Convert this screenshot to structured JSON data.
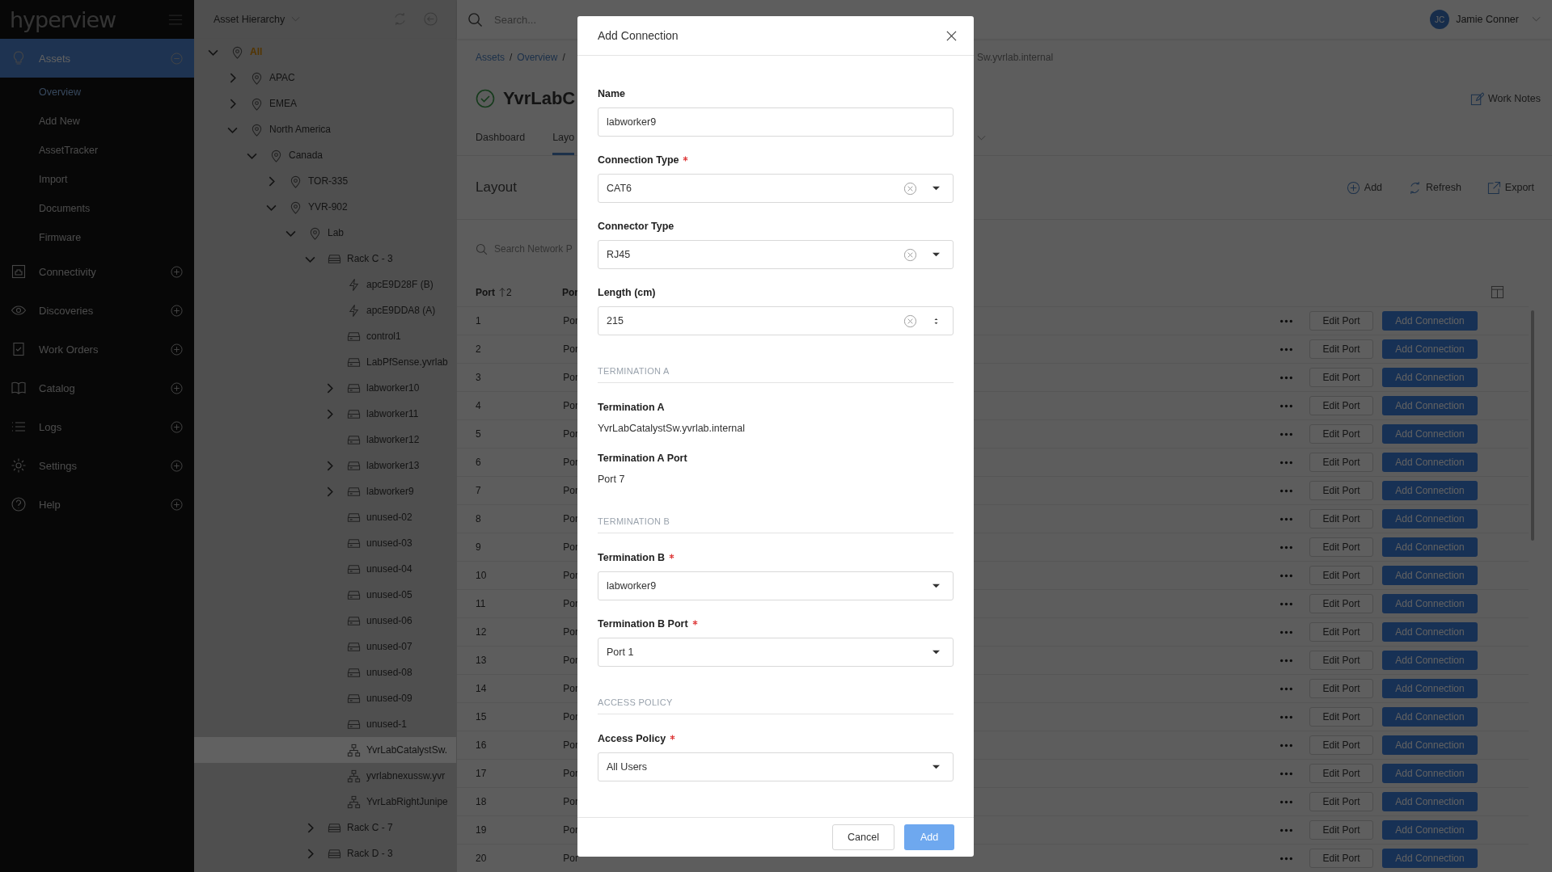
{
  "sidebar": {
    "logo": "hyperview",
    "items": [
      {
        "label": "Assets",
        "selected": true,
        "expanded": true,
        "children": [
          {
            "label": "Overview",
            "selected": true
          },
          {
            "label": "Add New",
            "selected": false
          },
          {
            "label": "AssetTracker",
            "selected": false
          },
          {
            "label": "Import",
            "selected": false
          },
          {
            "label": "Documents",
            "selected": false
          },
          {
            "label": "Firmware",
            "selected": false
          }
        ]
      },
      {
        "label": "Connectivity",
        "selected": false,
        "expanded": false
      },
      {
        "label": "Discoveries",
        "selected": false,
        "expanded": false
      },
      {
        "label": "Work Orders",
        "selected": false,
        "expanded": false
      },
      {
        "label": "Catalog",
        "selected": false,
        "expanded": false
      },
      {
        "label": "Logs",
        "selected": false,
        "expanded": false
      },
      {
        "label": "Settings",
        "selected": false,
        "expanded": false
      },
      {
        "label": "Help",
        "selected": false,
        "expanded": false
      }
    ]
  },
  "tree_panel": {
    "title": "Asset Hierarchy",
    "nodes": [
      {
        "label": "All",
        "kind": "location",
        "selected": false,
        "expanded": true,
        "children": [
          {
            "label": "APAC",
            "kind": "location",
            "selected": false,
            "expanded": false
          },
          {
            "label": "EMEA",
            "kind": "location",
            "selected": false,
            "expanded": false
          },
          {
            "label": "North America",
            "kind": "location",
            "selected": false,
            "expanded": true,
            "children": [
              {
                "label": "Canada",
                "kind": "location",
                "selected": false,
                "expanded": true,
                "children": [
                  {
                    "label": "TOR-335",
                    "kind": "location",
                    "selected": false,
                    "expanded": false
                  },
                  {
                    "label": "YVR-902",
                    "kind": "location",
                    "selected": false,
                    "expanded": true,
                    "children": [
                      {
                        "label": "Lab",
                        "kind": "location",
                        "selected": false,
                        "expanded": true,
                        "children": [
                          {
                            "label": "Rack C - 3",
                            "kind": "rack",
                            "selected": false,
                            "expanded": true,
                            "children": [
                              {
                                "label": "apcE9D28F (B)",
                                "kind": "pdu",
                                "selected": false
                              },
                              {
                                "label": "apcE9DDA8 (A)",
                                "kind": "pdu",
                                "selected": false
                              },
                              {
                                "label": "control1",
                                "kind": "server",
                                "selected": false
                              },
                              {
                                "label": "LabPfSense.yvrlab",
                                "kind": "server",
                                "selected": false
                              },
                              {
                                "label": "labworker10",
                                "kind": "server",
                                "selected": false,
                                "expanded": false
                              },
                              {
                                "label": "labworker11",
                                "kind": "server",
                                "selected": false,
                                "expanded": false
                              },
                              {
                                "label": "labworker12",
                                "kind": "server",
                                "selected": false
                              },
                              {
                                "label": "labworker13",
                                "kind": "server",
                                "selected": false,
                                "expanded": false
                              },
                              {
                                "label": "labworker9",
                                "kind": "server",
                                "selected": false,
                                "expanded": false
                              },
                              {
                                "label": "unused-02",
                                "kind": "server",
                                "selected": false
                              },
                              {
                                "label": "unused-03",
                                "kind": "server",
                                "selected": false
                              },
                              {
                                "label": "unused-04",
                                "kind": "server",
                                "selected": false
                              },
                              {
                                "label": "unused-05",
                                "kind": "server",
                                "selected": false
                              },
                              {
                                "label": "unused-06",
                                "kind": "server",
                                "selected": false
                              },
                              {
                                "label": "unused-07",
                                "kind": "server",
                                "selected": false
                              },
                              {
                                "label": "unused-08",
                                "kind": "server",
                                "selected": false
                              },
                              {
                                "label": "unused-09",
                                "kind": "server",
                                "selected": false
                              },
                              {
                                "label": "unused-1",
                                "kind": "server",
                                "selected": false
                              },
                              {
                                "label": "YvrLabCatalystSw.",
                                "kind": "switch",
                                "selected": true
                              },
                              {
                                "label": "yvrlabnexussw.yvr",
                                "kind": "switch",
                                "selected": false
                              },
                              {
                                "label": "YvrLabRightJunipe",
                                "kind": "switch",
                                "selected": false
                              }
                            ]
                          },
                          {
                            "label": "Rack C - 7",
                            "kind": "rack",
                            "selected": false,
                            "expanded": false
                          },
                          {
                            "label": "Rack D - 3",
                            "kind": "rack",
                            "selected": false,
                            "expanded": false
                          }
                        ]
                      }
                    ]
                  }
                ]
              }
            ]
          }
        ]
      }
    ]
  },
  "top_bar": {
    "search": {
      "placeholder": "Search..."
    },
    "user": {
      "initials": "JC",
      "name": "Jamie Conner"
    }
  },
  "breadcrumb": {
    "items": [
      "Assets",
      "Overview"
    ],
    "separator": "/",
    "tail": "Sw.yvrlab.internal"
  },
  "page": {
    "title": "YvrLabC",
    "work_notes": "Work Notes",
    "tabs": [
      {
        "label": "Dashboard",
        "selected": false
      },
      {
        "label": "Layo",
        "selected": true
      }
    ]
  },
  "layout": {
    "heading": "Layout",
    "actions": [
      "Add",
      "Refresh",
      "Export"
    ],
    "search": {
      "placeholder": "Search Network P"
    },
    "columns": [
      "Port",
      "Por"
    ],
    "sort_order": "2",
    "rows": [
      {
        "port": "1",
        "column_2": "Por",
        "edit": "Edit Port",
        "add": "Add Connection"
      },
      {
        "port": "2",
        "column_2": "Por",
        "edit": "Edit Port",
        "add": "Add Connection"
      },
      {
        "port": "3",
        "column_2": "Por",
        "edit": "Edit Port",
        "add": "Add Connection"
      },
      {
        "port": "4",
        "column_2": "Por",
        "edit": "Edit Port",
        "add": "Add Connection"
      },
      {
        "port": "5",
        "column_2": "Por",
        "edit": "Edit Port",
        "add": "Add Connection"
      },
      {
        "port": "6",
        "column_2": "Por",
        "edit": "Edit Port",
        "add": "Add Connection"
      },
      {
        "port": "7",
        "column_2": "Por",
        "edit": "Edit Port",
        "add": "Add Connection"
      },
      {
        "port": "8",
        "column_2": "Por",
        "edit": "Edit Port",
        "add": "Add Connection"
      },
      {
        "port": "9",
        "column_2": "Por",
        "edit": "Edit Port",
        "add": "Add Connection"
      },
      {
        "port": "10",
        "column_2": "Por",
        "edit": "Edit Port",
        "add": "Add Connection"
      },
      {
        "port": "11",
        "column_2": "Por",
        "edit": "Edit Port",
        "add": "Add Connection"
      },
      {
        "port": "12",
        "column_2": "Por",
        "edit": "Edit Port",
        "add": "Add Connection"
      },
      {
        "port": "13",
        "column_2": "Por",
        "edit": "Edit Port",
        "add": "Add Connection"
      },
      {
        "port": "14",
        "column_2": "Por",
        "edit": "Edit Port",
        "add": "Add Connection"
      },
      {
        "port": "15",
        "column_2": "Por",
        "edit": "Edit Port",
        "add": "Add Connection"
      },
      {
        "port": "16",
        "column_2": "Por",
        "edit": "Edit Port",
        "add": "Add Connection"
      },
      {
        "port": "17",
        "column_2": "Por",
        "edit": "Edit Port",
        "add": "Add Connection"
      },
      {
        "port": "18",
        "column_2": "Por",
        "edit": "Edit Port",
        "add": "Add Connection"
      },
      {
        "port": "19",
        "column_2": "Por",
        "edit": "Edit Port",
        "add": "Add Connection"
      },
      {
        "port": "20",
        "column_2": "Por",
        "edit": "Edit Port",
        "add": "Add Connection"
      }
    ]
  },
  "dialog": {
    "title": "Add Connection",
    "fields": [
      {
        "kind": "text",
        "label": "Name",
        "required": false,
        "value": "labworker9"
      },
      {
        "kind": "select",
        "label": "Connection Type",
        "required": true,
        "value": "CAT6",
        "clearable": true
      },
      {
        "kind": "select",
        "label": "Connector Type",
        "required": false,
        "value": "RJ45",
        "clearable": true
      },
      {
        "kind": "number",
        "label": "Length (cm)",
        "required": false,
        "value": "215",
        "clearable": true
      },
      {
        "kind": "section",
        "label": "TERMINATION A"
      },
      {
        "kind": "readonly",
        "label": "Termination A",
        "value": "YvrLabCatalystSw.yvrlab.internal"
      },
      {
        "kind": "readonly",
        "label": "Termination A Port",
        "value": "Port 7"
      },
      {
        "kind": "section",
        "label": "TERMINATION B"
      },
      {
        "kind": "select",
        "label": "Termination B",
        "required": true,
        "value": "labworker9",
        "clearable": false
      },
      {
        "kind": "select",
        "label": "Termination B Port",
        "required": true,
        "value": "Port 1",
        "clearable": false
      },
      {
        "kind": "section",
        "label": "ACCESS POLICY"
      },
      {
        "kind": "select",
        "label": "Access Policy",
        "required": true,
        "value": "All Users",
        "clearable": false
      }
    ],
    "buttons": [
      {
        "label": "Cancel",
        "kind": "secondary"
      },
      {
        "label": "Add",
        "kind": "primary"
      }
    ]
  }
}
